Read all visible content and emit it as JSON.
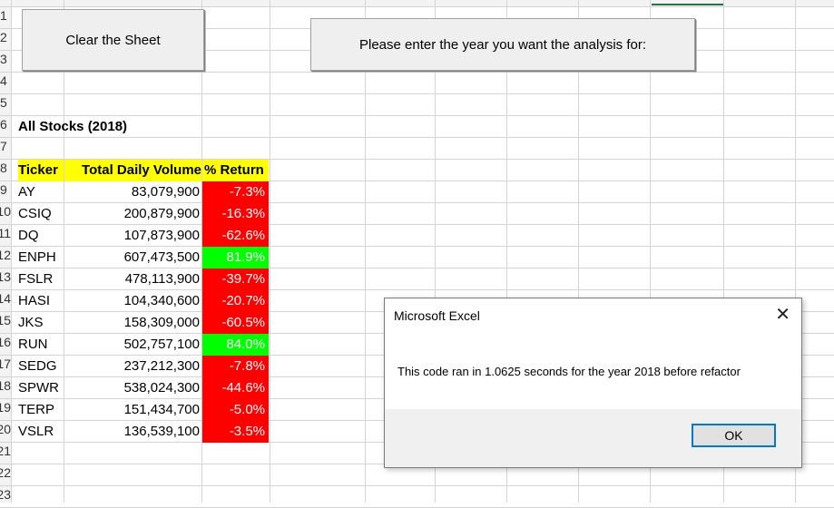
{
  "row_numbers": [
    "1",
    "2",
    "3",
    "4",
    "5",
    "6",
    "7",
    "8",
    "9",
    "10",
    "11",
    "12",
    "13",
    "14",
    "15",
    "16",
    "17",
    "18",
    "19",
    "20",
    "21",
    "22",
    "23"
  ],
  "buttons": {
    "clear_label": "Clear the Sheet",
    "prompt_label": "Please enter the year you want the analysis for:"
  },
  "sheet": {
    "title": "All Stocks (2018)",
    "headers": {
      "ticker": "Ticker",
      "volume": "Total Daily Volume",
      "return": "% Return"
    },
    "rows": [
      {
        "ticker": "AY",
        "volume": "83,079,900",
        "return": "-7.3%",
        "status": "negative"
      },
      {
        "ticker": "CSIQ",
        "volume": "200,879,900",
        "return": "-16.3%",
        "status": "negative"
      },
      {
        "ticker": "DQ",
        "volume": "107,873,900",
        "return": "-62.6%",
        "status": "negative"
      },
      {
        "ticker": "ENPH",
        "volume": "607,473,500",
        "return": "81.9%",
        "status": "positive"
      },
      {
        "ticker": "FSLR",
        "volume": "478,113,900",
        "return": "-39.7%",
        "status": "negative"
      },
      {
        "ticker": "HASI",
        "volume": "104,340,600",
        "return": "-20.7%",
        "status": "negative"
      },
      {
        "ticker": "JKS",
        "volume": "158,309,000",
        "return": "-60.5%",
        "status": "negative"
      },
      {
        "ticker": "RUN",
        "volume": "502,757,100",
        "return": "84.0%",
        "status": "positive"
      },
      {
        "ticker": "SEDG",
        "volume": "237,212,300",
        "return": "-7.8%",
        "status": "negative"
      },
      {
        "ticker": "SPWR",
        "volume": "538,024,300",
        "return": "-44.6%",
        "status": "negative"
      },
      {
        "ticker": "TERP",
        "volume": "151,434,700",
        "return": "-5.0%",
        "status": "negative"
      },
      {
        "ticker": "VSLR",
        "volume": "136,539,100",
        "return": "-3.5%",
        "status": "negative"
      }
    ]
  },
  "colors": {
    "header_fill": "#ffff00",
    "negative_fill": "#ff0000",
    "positive_fill": "#00ff00",
    "accent": "#0078d7"
  },
  "dialog": {
    "title": "Microsoft Excel",
    "close_icon": "close-icon",
    "message": "This code ran in 1.0625 seconds for the year 2018 before refactor",
    "ok_label": "OK"
  }
}
